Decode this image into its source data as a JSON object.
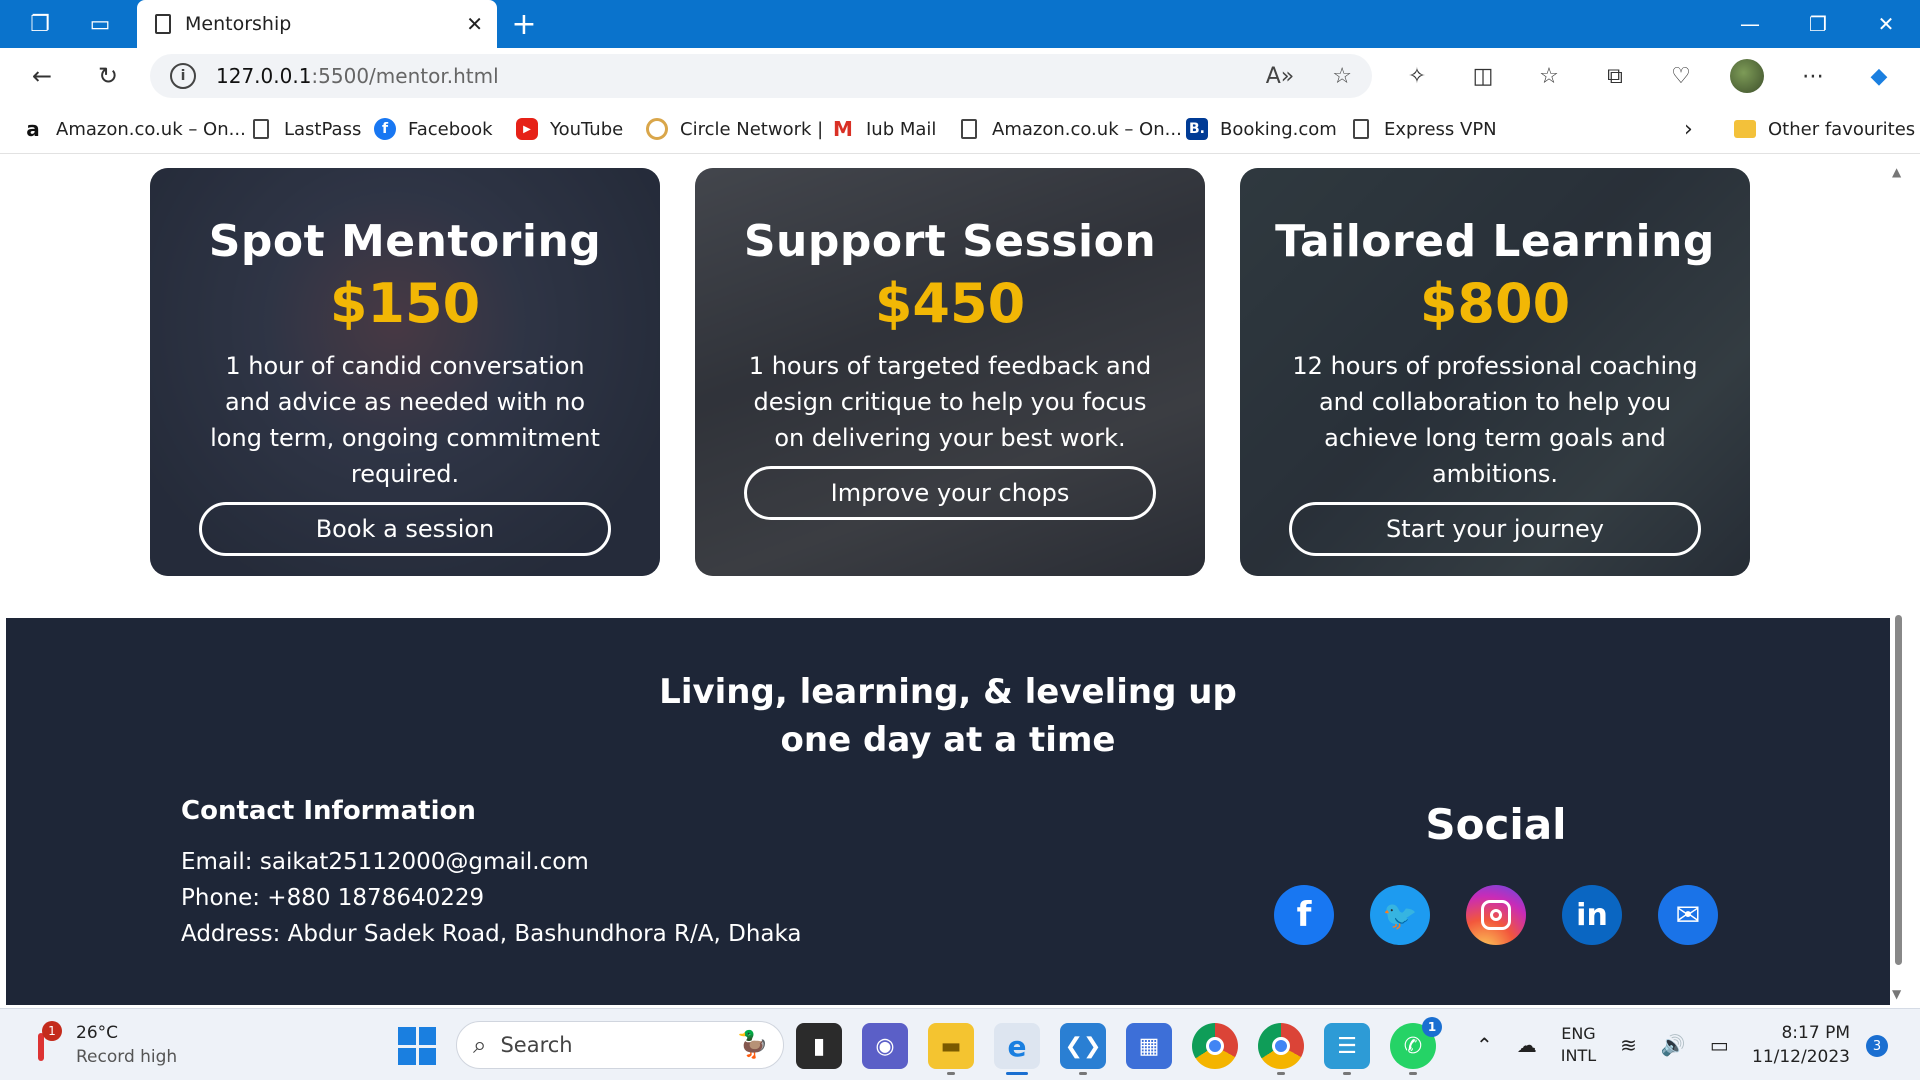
{
  "browser": {
    "tab_title": "Mentorship",
    "url_host": "127.0.0.1",
    "url_path": ":5500/mentor.html",
    "favourites": [
      {
        "label": "Amazon.co.uk – On...",
        "icon": "amazon-icon"
      },
      {
        "label": "LastPass",
        "icon": "document-icon"
      },
      {
        "label": "Facebook",
        "icon": "facebook-icon"
      },
      {
        "label": "YouTube",
        "icon": "youtube-icon"
      },
      {
        "label": "Circle Network |",
        "icon": "circle-network-icon"
      },
      {
        "label": "Iub Mail",
        "icon": "gmail-icon"
      },
      {
        "label": "Amazon.co.uk – On...",
        "icon": "document-icon"
      },
      {
        "label": "Booking.com",
        "icon": "booking-icon"
      },
      {
        "label": "Express VPN",
        "icon": "document-icon"
      }
    ],
    "other_favourites": "Other favourites"
  },
  "cards": [
    {
      "title": "Spot Mentoring",
      "price": "$150",
      "description": "1 hour of candid conversation and advice as needed with no long term, ongoing commitment required.",
      "button": "Book a session"
    },
    {
      "title": "Support Session",
      "price": "$450",
      "description": "1 hours of targeted feedback and design critique to help you focus on delivering your best work.",
      "button": "Improve your chops"
    },
    {
      "title": "Tailored Learning",
      "price": "$800",
      "description": "12 hours of professional coaching and collaboration to help you achieve long term goals and ambitions.",
      "button": "Start your journey"
    }
  ],
  "footer": {
    "tagline_line1": "Living, learning, & leveling up",
    "tagline_line2": "one day at a time",
    "contact_heading": "Contact Information",
    "email": "Email: saikat25112000@gmail.com",
    "phone": "Phone: +880 1878640229",
    "address": "Address: Abdur Sadek Road, Bashundhora R/A, Dhaka",
    "social_heading": "Social",
    "social_icons": [
      "facebook-icon",
      "twitter-icon",
      "instagram-icon",
      "linkedin-icon",
      "mail-icon"
    ]
  },
  "taskbar": {
    "weather_badge": "1",
    "temperature": "26°C",
    "weather_note": "Record high",
    "search_placeholder": "Search",
    "whatsapp_badge": "1",
    "lang_line1": "ENG",
    "lang_line2": "INTL",
    "time": "8:17 PM",
    "date": "11/12/2023",
    "notification_count": "3"
  },
  "colors": {
    "titlebar": "#0a73cc",
    "price": "#f2b705",
    "footer_bg": "#1e2637"
  }
}
